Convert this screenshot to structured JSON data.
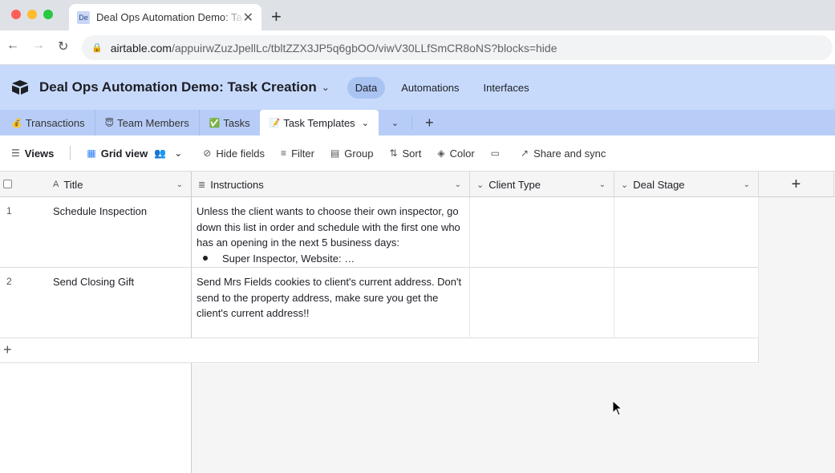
{
  "browser": {
    "tab_title": "Deal Ops Automation Demo: Task Creation",
    "favicon_text": "De",
    "url_host": "airtable.com",
    "url_path": "/appuirwZuzJpellLc/tbltZZX3JP5q6gbOO/viwV30LLfSmCR8oNS?blocks=hide"
  },
  "app": {
    "base_name": "Deal Ops Automation Demo: Task Creation",
    "nav": [
      "Data",
      "Automations",
      "Interfaces"
    ],
    "active_nav": "Data",
    "header_color": "#c8dafc"
  },
  "tables": [
    {
      "emoji": "💰",
      "label": "Transactions"
    },
    {
      "emoji": "😇",
      "label": "Team Members"
    },
    {
      "emoji": "✅",
      "label": "Tasks"
    },
    {
      "emoji": "📝",
      "label": "Task Templates"
    }
  ],
  "toolbar": {
    "views": "Views",
    "view_name": "Grid view",
    "hide_fields": "Hide fields",
    "filter": "Filter",
    "group": "Group",
    "sort": "Sort",
    "color": "Color",
    "share": "Share and sync"
  },
  "grid": {
    "columns": [
      "Title",
      "Instructions",
      "Client Type",
      "Deal Stage"
    ],
    "rows": [
      {
        "num": "1",
        "title": "Schedule Inspection",
        "instructions": "Unless the client wants to choose their own inspector, go down this list in order and schedule with the first one who has an opening in the next 5 business days:",
        "instructions_bullet": "Super Inspector, Website: …",
        "client_type": "",
        "deal_stage": ""
      },
      {
        "num": "2",
        "title": "Send Closing Gift",
        "instructions": "Send Mrs Fields cookies to client's current address. Don't send to the property address, make sure you get the client's current address!!",
        "instructions_bullet": "",
        "client_type": "",
        "deal_stage": ""
      }
    ]
  }
}
